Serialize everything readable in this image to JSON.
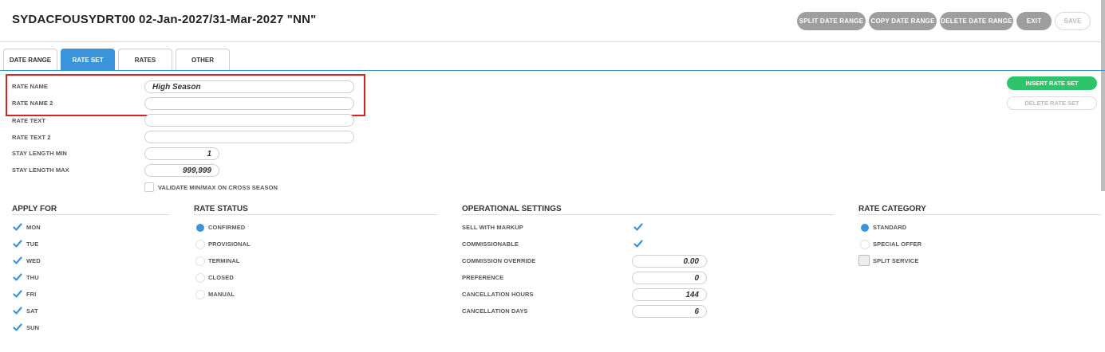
{
  "header": {
    "title": "SYDACFOUSYDRT00 02-Jan-2027/31-Mar-2027 \"NN\"",
    "buttons": {
      "split": "SPLIT DATE RANGE",
      "copy": "COPY DATE RANGE",
      "delete": "DELETE DATE RANGE",
      "exit": "EXIT",
      "save": "SAVE"
    }
  },
  "tabs": [
    "DATE RANGE",
    "RATE SET",
    "RATES",
    "OTHER"
  ],
  "active_tab": "RATE SET",
  "form": {
    "rate_name": {
      "label": "RATE NAME",
      "value": "High Season"
    },
    "rate_name_2": {
      "label": "RATE NAME 2",
      "value": ""
    },
    "rate_text": {
      "label": "RATE TEXT",
      "value": ""
    },
    "rate_text_2": {
      "label": "RATE TEXT 2",
      "value": ""
    },
    "stay_min": {
      "label": "STAY LENGTH MIN",
      "value": "1"
    },
    "stay_max": {
      "label": "STAY LENGTH MAX",
      "value": "999,999"
    },
    "validate": {
      "label": "VALIDATE MIN/MAX ON CROSS SEASON",
      "checked": false
    }
  },
  "side_buttons": {
    "insert": "INSERT RATE SET",
    "delete": "DELETE RATE SET"
  },
  "apply_for": {
    "title": "APPLY FOR",
    "days": [
      {
        "label": "MON",
        "checked": true
      },
      {
        "label": "TUE",
        "checked": true
      },
      {
        "label": "WED",
        "checked": true
      },
      {
        "label": "THU",
        "checked": true
      },
      {
        "label": "FRI",
        "checked": true
      },
      {
        "label": "SAT",
        "checked": true
      },
      {
        "label": "SUN",
        "checked": true
      }
    ]
  },
  "rate_status": {
    "title": "RATE STATUS",
    "options": [
      "CONFIRMED",
      "PROVISIONAL",
      "TERMINAL",
      "CLOSED",
      "MANUAL"
    ],
    "selected": "CONFIRMED"
  },
  "operational": {
    "title": "OPERATIONAL SETTINGS",
    "sell_with_markup": {
      "label": "SELL WITH MARKUP",
      "checked": true
    },
    "commissionable": {
      "label": "COMMISSIONABLE",
      "checked": true
    },
    "commission_override": {
      "label": "COMMISSION OVERRIDE",
      "value": "0.00"
    },
    "preference": {
      "label": "PREFERENCE",
      "value": "0"
    },
    "cancellation_hours": {
      "label": "CANCELLATION HOURS",
      "value": "144"
    },
    "cancellation_days": {
      "label": "CANCELLATION DAYS",
      "value": "6"
    }
  },
  "rate_category": {
    "title": "RATE CATEGORY",
    "options": [
      "STANDARD",
      "SPECIAL OFFER"
    ],
    "selected": "STANDARD",
    "split_service": {
      "label": "SPLIT SERVICE",
      "checked": false
    }
  },
  "colors": {
    "accent": "#3a94dc",
    "green": "#2dc56a",
    "highlight": "#d6232a",
    "button_gray": "#9e9e9e"
  }
}
